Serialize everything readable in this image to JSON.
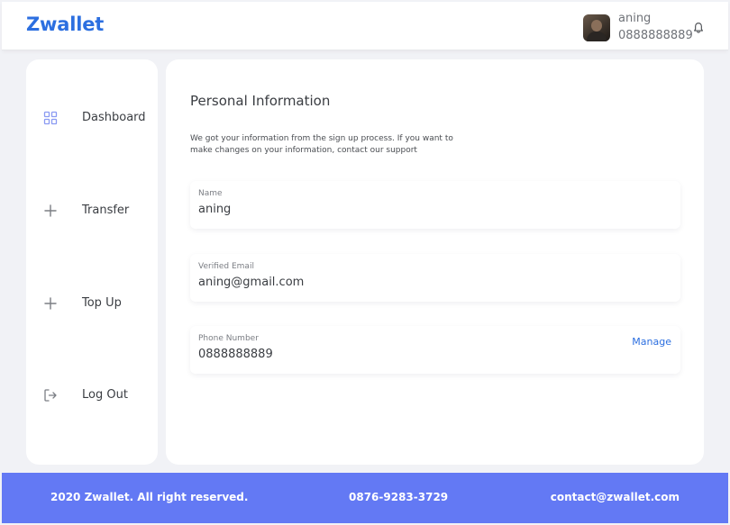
{
  "header": {
    "brand": "Zwallet",
    "user": {
      "name": "aning",
      "phone": "0888888889"
    },
    "icons": {
      "notification": "bell-icon",
      "avatar": "user-photo"
    }
  },
  "sidebar": {
    "items": [
      {
        "label": "Dashboard",
        "icon": "grid-icon",
        "active": false
      },
      {
        "label": "Transfer",
        "icon": "plus-icon",
        "active": false
      },
      {
        "label": "Top Up",
        "icon": "plus-icon",
        "active": false
      },
      {
        "label": "Log Out",
        "icon": "logout-icon",
        "active": false
      }
    ]
  },
  "main": {
    "title": "Personal Information",
    "description": "We got your information from the sign up process. If you want to make changes on your information, contact our support",
    "fields": [
      {
        "label": "Name",
        "value": "aning"
      },
      {
        "label": "Verified Email",
        "value": "aning@gmail.com"
      },
      {
        "label": "Phone Number",
        "value": "0888888889",
        "action": "Manage"
      }
    ]
  },
  "footer": {
    "copyright": "2020 Zwallet. All right reserved.",
    "phone": "0876-9283-3729",
    "email": "contact@zwallet.com"
  },
  "colors": {
    "brand": "#2c6fe0",
    "footer_bg": "#6379f4",
    "page_bg": "#f1f2f6",
    "icon_accent": "#8a9af2"
  }
}
